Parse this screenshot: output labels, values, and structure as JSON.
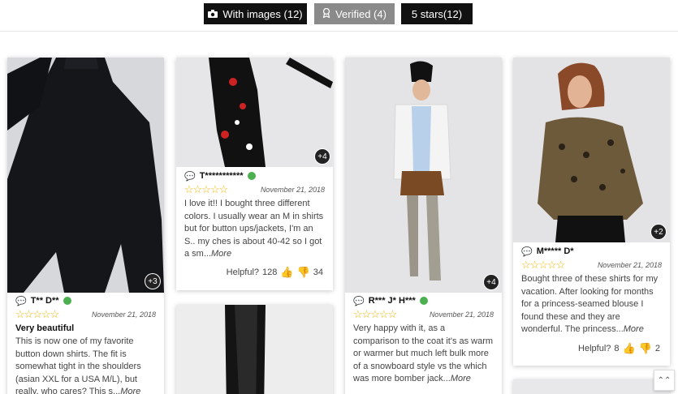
{
  "filters": {
    "with_images": "With images (12)",
    "verified": "Verified (4)",
    "five_stars": "5 stars(12)"
  },
  "cards": [
    {
      "badge": "+3",
      "reviewer": "T** D**",
      "stars": "☆☆☆☆☆",
      "date": "November 21, 2018",
      "title": "Very beautiful",
      "text": "This is now one of my favorite button down shirts. The fit is somewhat tight in the shoulders (asian XXL for a USA M/L), but really, who cares? This s...",
      "more": "More"
    },
    {
      "badge": "+4",
      "reviewer": "T***********",
      "stars": "☆☆☆☆☆",
      "date": "November 21, 2018",
      "text": "I love it!! I bought three different colors. I usually wear an M in shirts but for button ups/jackets, I'm an S.. my ches is about 40-42 so I got a sm...",
      "more": "More",
      "helpful_label": "Helpful?",
      "up": "128",
      "down": "34"
    },
    {
      "badge": "+4",
      "reviewer": "R*** J* H***",
      "stars": "☆☆☆☆☆",
      "date": "November 21, 2018",
      "text": "Very happy with it, as a comparison to the coat it's as warm or warmer but much left bulk more of a snowboard style vs the which was more bomber jack...",
      "more": "More"
    },
    {
      "badge": "+2",
      "reviewer": "M***** D*",
      "stars": "☆☆☆☆☆",
      "date": "November 21, 2018",
      "text": "Bought three of these shirts for my vacation. After looking for months for a princess-seamed blouse I found these and they are wonderful. The princess...",
      "more": "More",
      "helpful_label": "Helpful?",
      "up": "8",
      "down": "2"
    }
  ],
  "scroll_top_icon": "double-chevron-up-icon"
}
